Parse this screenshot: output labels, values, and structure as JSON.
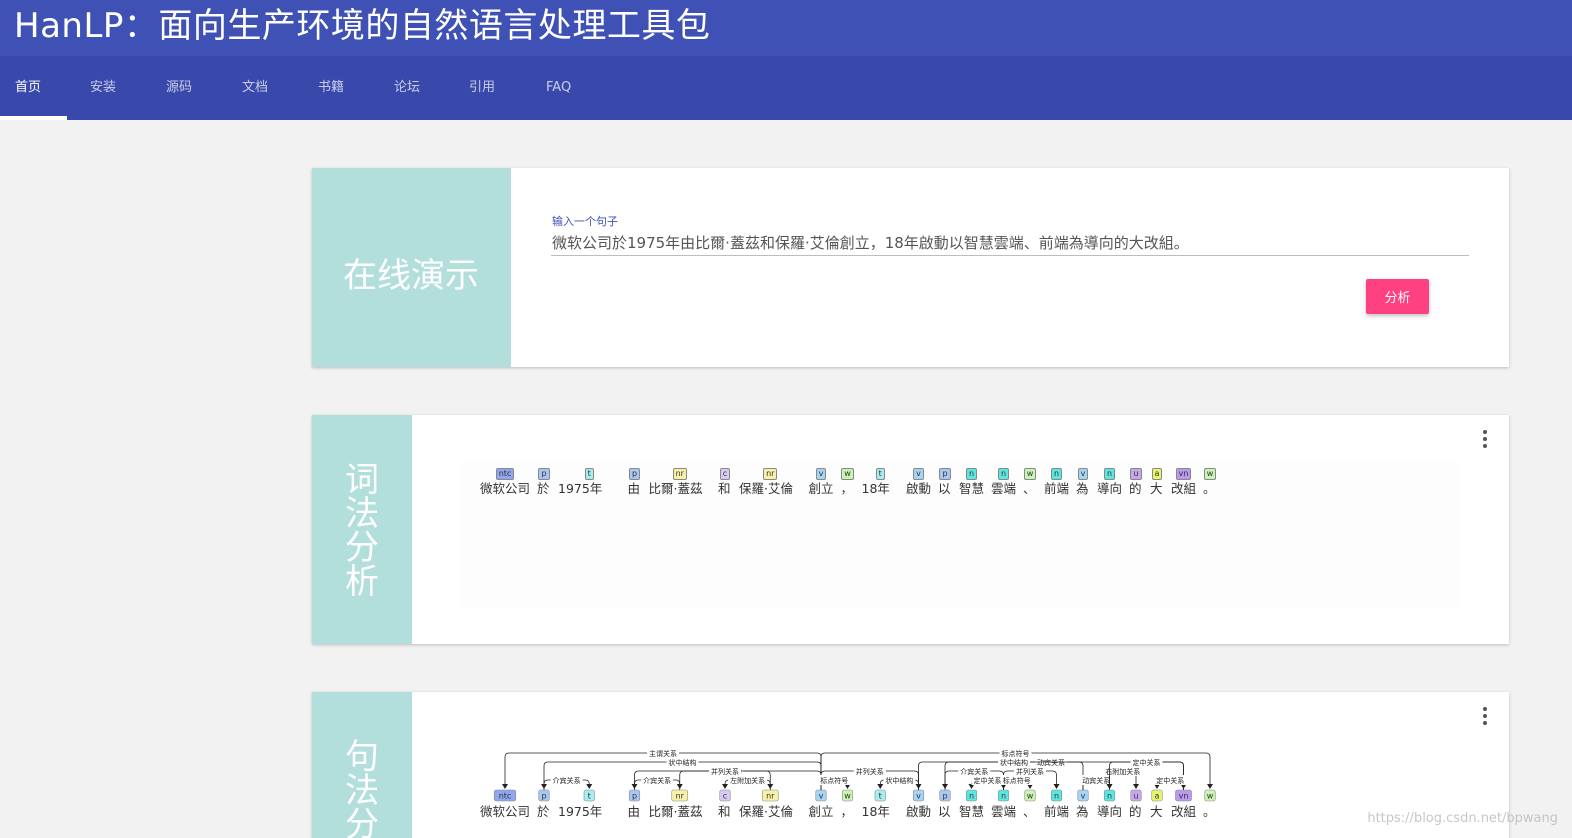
{
  "header": {
    "title": "HanLP：面向生产环境的自然语言处理工具包"
  },
  "nav": {
    "items": [
      "首页",
      "安装",
      "源码",
      "文档",
      "书籍",
      "论坛",
      "引用",
      "FAQ"
    ]
  },
  "demo": {
    "section_title": "在线演示",
    "input_label": "输入一个句子",
    "input_value": "微软公司於1975年由比爾·蓋茲和保羅·艾倫創立，18年啟動以智慧雲端、前端為導向的大改組。",
    "analyze_button": "分析"
  },
  "lexical": {
    "section_title": "词法分析",
    "tokens": [
      {
        "word": "微软公司",
        "tag": "ntc",
        "color": "#8fa6f0"
      },
      {
        "word": "於",
        "tag": "p",
        "color": "#a9c7f5"
      },
      {
        "word": "1975年",
        "tag": "t",
        "color": "#a6eef0"
      },
      {
        "word": "由",
        "tag": "p",
        "color": "#a9c7f5"
      },
      {
        "word": "比爾·蓋茲",
        "tag": "nr",
        "color": "#f7f1a8"
      },
      {
        "word": "和",
        "tag": "c",
        "color": "#d9c9f5"
      },
      {
        "word": "保羅·艾倫",
        "tag": "nr",
        "color": "#f7f1a8"
      },
      {
        "word": "創立",
        "tag": "v",
        "color": "#a6d4f5"
      },
      {
        "word": "，",
        "tag": "w",
        "color": "#c8f5b0"
      },
      {
        "word": "18年",
        "tag": "t",
        "color": "#a6eef0"
      },
      {
        "word": "啟動",
        "tag": "v",
        "color": "#a6d4f5"
      },
      {
        "word": "以",
        "tag": "p",
        "color": "#a9c7f5"
      },
      {
        "word": "智慧",
        "tag": "n",
        "color": "#5ce6e0"
      },
      {
        "word": "雲端",
        "tag": "n",
        "color": "#5ce6e0"
      },
      {
        "word": "、",
        "tag": "w",
        "color": "#c8f5b0"
      },
      {
        "word": "前端",
        "tag": "n",
        "color": "#5ce6e0"
      },
      {
        "word": "為",
        "tag": "v",
        "color": "#a6d4f5"
      },
      {
        "word": "導向",
        "tag": "n",
        "color": "#5ce6e0"
      },
      {
        "word": "的",
        "tag": "u",
        "color": "#c7a6f0"
      },
      {
        "word": "大",
        "tag": "a",
        "color": "#e8f56a"
      },
      {
        "word": "改組",
        "tag": "vn",
        "color": "#b99af0"
      },
      {
        "word": "。",
        "tag": "w",
        "color": "#c8f5b0"
      }
    ]
  },
  "syntax": {
    "section_title": "句法分析",
    "tokens": [
      {
        "word": "微软公司",
        "tag": "ntc",
        "color": "#8fa6f0"
      },
      {
        "word": "於",
        "tag": "p",
        "color": "#a9c7f5"
      },
      {
        "word": "1975年",
        "tag": "t",
        "color": "#a6eef0"
      },
      {
        "word": "由",
        "tag": "p",
        "color": "#a9c7f5"
      },
      {
        "word": "比爾·蓋茲",
        "tag": "nr",
        "color": "#f7f1a8"
      },
      {
        "word": "和",
        "tag": "c",
        "color": "#d9c9f5"
      },
      {
        "word": "保羅·艾倫",
        "tag": "nr",
        "color": "#f7f1a8"
      },
      {
        "word": "創立",
        "tag": "v",
        "color": "#a6d4f5"
      },
      {
        "word": "，",
        "tag": "w",
        "color": "#c8f5b0"
      },
      {
        "word": "18年",
        "tag": "t",
        "color": "#a6eef0"
      },
      {
        "word": "啟動",
        "tag": "v",
        "color": "#a6d4f5"
      },
      {
        "word": "以",
        "tag": "p",
        "color": "#a9c7f5"
      },
      {
        "word": "智慧",
        "tag": "n",
        "color": "#5ce6e0"
      },
      {
        "word": "雲端",
        "tag": "n",
        "color": "#5ce6e0"
      },
      {
        "word": "、",
        "tag": "w",
        "color": "#c8f5b0"
      },
      {
        "word": "前端",
        "tag": "n",
        "color": "#5ce6e0"
      },
      {
        "word": "為",
        "tag": "v",
        "color": "#a6d4f5"
      },
      {
        "word": "導向",
        "tag": "n",
        "color": "#5ce6e0"
      },
      {
        "word": "的",
        "tag": "u",
        "color": "#c7a6f0"
      },
      {
        "word": "大",
        "tag": "a",
        "color": "#e8f56a"
      },
      {
        "word": "改組",
        "tag": "vn",
        "color": "#b99af0"
      },
      {
        "word": "。",
        "tag": "w",
        "color": "#c8f5b0"
      }
    ],
    "arcs": [
      {
        "from": 7,
        "to": 0,
        "label": "主谓关系",
        "level": 3
      },
      {
        "from": 7,
        "to": 1,
        "label": "状中结构",
        "level": 2
      },
      {
        "from": 1,
        "to": 2,
        "label": "介宾关系",
        "level": 0
      },
      {
        "from": 7,
        "to": 3,
        "label": "状中结构",
        "level": 1
      },
      {
        "from": 3,
        "to": 4,
        "label": "介宾关系",
        "level": 0
      },
      {
        "from": 4,
        "to": 6,
        "label": "并列关系",
        "level": 1
      },
      {
        "from": 6,
        "to": 5,
        "label": "左附加关系",
        "level": 0
      },
      {
        "from": 7,
        "to": 21,
        "label": "标点符号",
        "level": 3
      },
      {
        "from": 7,
        "to": 10,
        "label": "并列关系",
        "level": 1
      },
      {
        "from": 7,
        "to": 8,
        "label": "标点符号",
        "level": 0
      },
      {
        "from": 10,
        "to": 9,
        "label": "状中结构",
        "level": 0
      },
      {
        "from": 10,
        "to": 20,
        "label": "动宾关系",
        "level": 2
      },
      {
        "from": 16,
        "to": 11,
        "label": "状中结构",
        "level": 2
      },
      {
        "from": 11,
        "to": 13,
        "label": "介宾关系",
        "level": 1
      },
      {
        "from": 13,
        "to": 12,
        "label": "定中关系",
        "level": 0
      },
      {
        "from": 13,
        "to": 15,
        "label": "并列关系",
        "level": 1
      },
      {
        "from": 13,
        "to": 14,
        "label": "标点符号",
        "level": 0
      },
      {
        "from": 16,
        "to": 17,
        "label": "动宾关系",
        "level": 0
      },
      {
        "from": 17,
        "to": 18,
        "label": "右附加关系",
        "level": 1
      },
      {
        "from": 20,
        "to": 17,
        "label": "定中关系",
        "level": 2
      },
      {
        "from": 20,
        "to": 19,
        "label": "定中关系",
        "level": 0
      }
    ]
  },
  "watermark": "https://blog.csdn.net/bpwang"
}
